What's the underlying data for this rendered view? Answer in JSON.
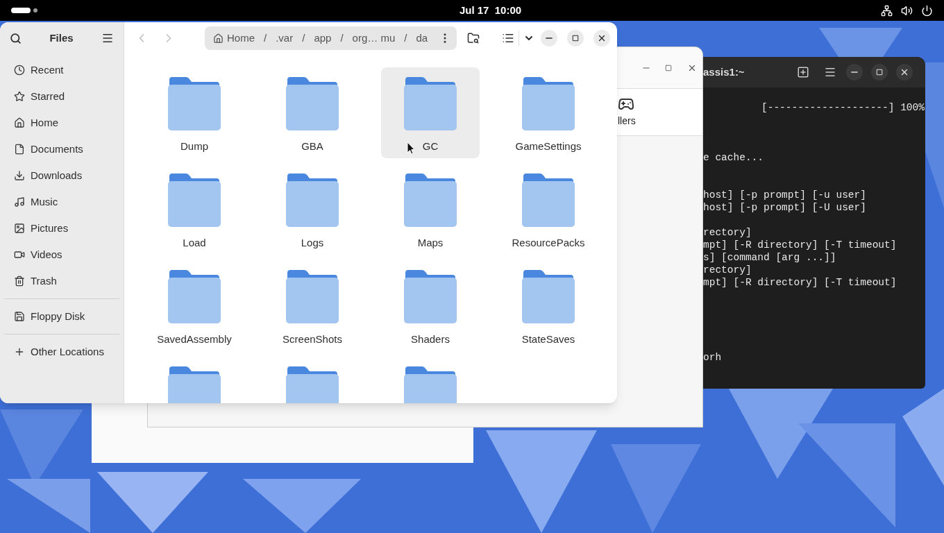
{
  "top_bar": {
    "clock": "Jul 17  10:00"
  },
  "files": {
    "title": "Files",
    "places": [
      {
        "kind": "recent",
        "label": "Recent"
      },
      {
        "kind": "starred",
        "label": "Starred"
      },
      {
        "kind": "home",
        "label": "Home"
      },
      {
        "kind": "documents",
        "label": "Documents"
      },
      {
        "kind": "downloads",
        "label": "Downloads"
      },
      {
        "kind": "music",
        "label": "Music"
      },
      {
        "kind": "pictures",
        "label": "Pictures"
      },
      {
        "kind": "videos",
        "label": "Videos"
      },
      {
        "kind": "trash",
        "label": "Trash"
      }
    ],
    "devices": [
      {
        "kind": "floppy",
        "label": "Floppy Disk"
      }
    ],
    "other_locations": "Other Locations",
    "back": {
      "disabled": true
    },
    "forward": {
      "disabled": true
    },
    "path": [
      {
        "kind": "home",
        "label": "Home"
      },
      {
        "kind": "separator",
        "label": "/"
      },
      {
        "kind": "folder",
        "label": ".var"
      },
      {
        "kind": "separator",
        "label": "/"
      },
      {
        "kind": "folder",
        "label": "app"
      },
      {
        "kind": "separator",
        "label": "/"
      },
      {
        "kind": "folder",
        "label": "org… mu"
      },
      {
        "kind": "separator",
        "label": "/"
      },
      {
        "kind": "folder",
        "label": "da"
      }
    ],
    "folders": [
      {
        "name": "Dump",
        "hovered": false
      },
      {
        "name": "GBA",
        "hovered": false
      },
      {
        "name": "GC",
        "hovered": true
      },
      {
        "name": "GameSettings",
        "hovered": false
      },
      {
        "name": "Load",
        "hovered": false
      },
      {
        "name": "Logs",
        "hovered": false
      },
      {
        "name": "Maps",
        "hovered": false
      },
      {
        "name": "ResourcePacks",
        "hovered": false
      },
      {
        "name": "SavedAssembly",
        "hovered": false
      },
      {
        "name": "ScreenShots",
        "hovered": false
      },
      {
        "name": "Shaders",
        "hovered": false
      },
      {
        "name": "StateSaves",
        "hovered": false
      },
      {
        "hovered": false
      },
      {
        "hovered": false
      },
      {
        "hovered": false
      }
    ]
  },
  "back_window": {
    "item_label": "llers"
  },
  "terminal": {
    "title": "assis1:~",
    "lines": [
      "[--------------------] 100%",
      "e cache...",
      "host] [-p prompt] [-u user]",
      "host] [-p prompt] [-U user]",
      "rectory]",
      "mpt] [-R directory] [-T timeout]",
      "s] [command [arg ...]]",
      "rectory]",
      "mpt] [-R directory] [-T timeout]",
      "orh"
    ]
  }
}
